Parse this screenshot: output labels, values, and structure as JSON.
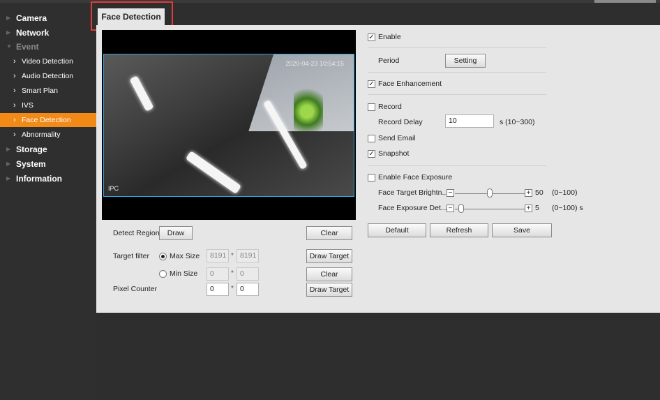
{
  "sidebar": {
    "sections": [
      {
        "label": "Camera"
      },
      {
        "label": "Network"
      },
      {
        "label": "Event"
      },
      {
        "label": "Storage"
      },
      {
        "label": "System"
      },
      {
        "label": "Information"
      }
    ],
    "event_items": [
      {
        "label": "Video Detection"
      },
      {
        "label": "Audio Detection"
      },
      {
        "label": "Smart Plan"
      },
      {
        "label": "IVS"
      },
      {
        "label": "Face Detection",
        "active": true
      },
      {
        "label": "Abnormality"
      }
    ]
  },
  "tab": {
    "label": "Face Detection"
  },
  "video": {
    "timestamp": "2020-04-23 10:54:15",
    "channel": "IPC"
  },
  "left": {
    "detect_region_label": "Detect Region",
    "draw_label": "Draw",
    "clear_label": "Clear",
    "target_filter_label": "Target filter",
    "max_size_label": "Max Size",
    "max_w": "8191",
    "max_h": "8191",
    "draw_target_label": "Draw Target",
    "min_size_label": "Min Size",
    "min_w": "0",
    "min_h": "0",
    "clear2_label": "Clear",
    "pixel_counter_label": "Pixel Counter",
    "pc_w": "0",
    "pc_h": "0",
    "draw_target2_label": "Draw Target",
    "star": "*"
  },
  "right": {
    "enable_label": "Enable",
    "enable_checked": true,
    "period_label": "Period",
    "setting_label": "Setting",
    "face_enhancement_label": "Face Enhancement",
    "face_enhancement_checked": true,
    "record_label": "Record",
    "record_checked": false,
    "record_delay_label": "Record Delay",
    "record_delay_value": "10",
    "record_delay_range": "s (10~300)",
    "send_email_label": "Send Email",
    "send_email_checked": false,
    "snapshot_label": "Snapshot",
    "snapshot_checked": true,
    "enable_face_exposure_label": "Enable Face Exposure",
    "enable_face_exposure_checked": false,
    "face_target_label": "Face Target Brightn...",
    "face_target_value": "50",
    "face_target_range": "(0~100)",
    "face_exposure_label": "Face Exposure Det...",
    "face_exposure_value": "5",
    "face_exposure_range": "(0~100) s",
    "minus": "−",
    "plus": "+",
    "default_label": "Default",
    "refresh_label": "Refresh",
    "save_label": "Save"
  },
  "colors": {
    "accent": "#f28a17",
    "sidebar_bg": "#2f2f2f",
    "content_bg": "#e6e6e6",
    "highlight": "#e03a3a",
    "video_border": "#2aa6e0"
  }
}
